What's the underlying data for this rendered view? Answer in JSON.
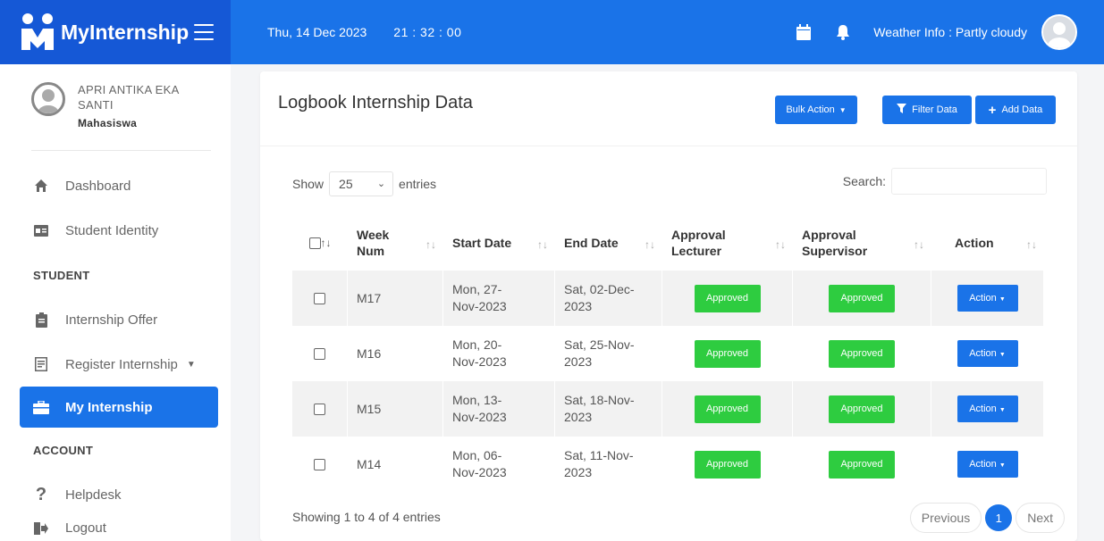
{
  "brand": {
    "name": "MyInternship"
  },
  "navbar": {
    "date": "Thu, 14 Dec 2023",
    "time": "21 : 32 : 00",
    "weather": "Weather Info : Partly cloudy"
  },
  "sidebar": {
    "profile": {
      "name": "APRI ANTIKA EKA SANTI",
      "role": "Mahasiswa"
    },
    "items": [
      {
        "label": "Dashboard",
        "icon": "home-icon"
      },
      {
        "label": "Student Identity",
        "icon": "id-card-icon"
      },
      {
        "heading": "STUDENT"
      },
      {
        "label": "Internship Offer",
        "icon": "clipboard-icon"
      },
      {
        "label": "Register Internship",
        "icon": "form-icon"
      },
      {
        "label": "My Internship",
        "icon": "briefcase-icon",
        "active": true
      },
      {
        "heading": "ACCOUNT"
      },
      {
        "label": "Helpdesk",
        "icon": "question-icon"
      },
      {
        "label": "Logout",
        "icon": "logout-icon"
      }
    ]
  },
  "card": {
    "title": "Logbook Internship Data",
    "buttons": {
      "bulk": "Bulk Action",
      "filter": "Filter Data",
      "add": "Add Data"
    }
  },
  "controls": {
    "show_label": "Show",
    "entries_value": "25",
    "entries_label": "entries",
    "search_label": "Search:",
    "search_value": ""
  },
  "table": {
    "columns": [
      "Week Num",
      "Start Date",
      "End Date",
      "Approval Lecturer",
      "Approval Supervisor",
      "Action"
    ],
    "rows": [
      {
        "week": "M17",
        "start": "Mon, 27-Nov-2023",
        "end": "Sat, 02-Dec-2023",
        "lecturer": "Approved",
        "supervisor": "Approved",
        "action": "Action"
      },
      {
        "week": "M16",
        "start": "Mon, 20-Nov-2023",
        "end": "Sat, 25-Nov-2023",
        "lecturer": "Approved",
        "supervisor": "Approved",
        "action": "Action"
      },
      {
        "week": "M15",
        "start": "Mon, 13-Nov-2023",
        "end": "Sat, 18-Nov-2023",
        "lecturer": "Approved",
        "supervisor": "Approved",
        "action": "Action"
      },
      {
        "week": "M14",
        "start": "Mon, 06-Nov-2023",
        "end": "Sat, 11-Nov-2023",
        "lecturer": "Approved",
        "supervisor": "Approved",
        "action": "Action"
      }
    ]
  },
  "footer": {
    "info": "Showing 1 to 4 of 4 entries",
    "previous": "Previous",
    "page": "1",
    "next": "Next"
  },
  "colors": {
    "brand_dark": "#1558d6",
    "brand": "#1a73e8",
    "approved": "#2ecc40"
  }
}
